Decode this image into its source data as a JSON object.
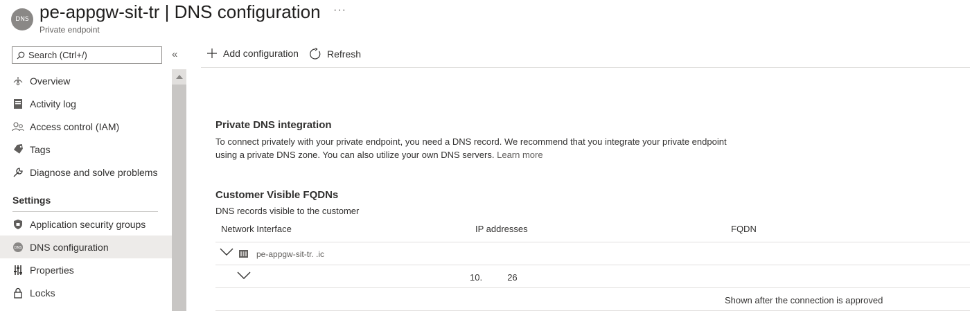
{
  "header": {
    "icon_text": "DNS",
    "resource_name": "pe-appgw-sit-tr",
    "separator": " | ",
    "page_name": "DNS configuration",
    "more": "···",
    "subtitle": "Private endpoint"
  },
  "sidebar": {
    "search_placeholder": "Search (Ctrl+/)",
    "collapse": "«",
    "items": [
      {
        "label": "Overview",
        "icon": "overview-icon"
      },
      {
        "label": "Activity log",
        "icon": "activity-log-icon"
      },
      {
        "label": "Access control (IAM)",
        "icon": "access-control-icon"
      },
      {
        "label": "Tags",
        "icon": "tag-icon"
      },
      {
        "label": "Diagnose and solve problems",
        "icon": "wrench-icon"
      }
    ],
    "settings_header": "Settings",
    "settings_items": [
      {
        "label": "Application security groups",
        "icon": "shield-icon"
      },
      {
        "label": "DNS configuration",
        "icon": "dns-icon",
        "selected": true
      },
      {
        "label": "Properties",
        "icon": "properties-icon"
      },
      {
        "label": "Locks",
        "icon": "lock-icon"
      }
    ]
  },
  "toolbar": {
    "add_label": "Add configuration",
    "refresh_label": "Refresh"
  },
  "main": {
    "integration_title": "Private DNS integration",
    "integration_text": "To connect privately with your private endpoint, you need a DNS record. We recommend that you integrate your private endpoint using a private DNS zone. You can also utilize your own DNS servers.",
    "learn_more": "Learn more",
    "fqdn_title": "Customer Visible FQDNs",
    "fqdn_subtitle": "DNS records visible to the customer",
    "columns": [
      "Network Interface",
      "IP addresses",
      "FQDN"
    ],
    "nic_name": "pe-appgw-sit-tr.  .ic",
    "ip_address": "10.          26",
    "fqdn_note": "Shown after the connection is approved"
  },
  "colors": {
    "selected_bg": "#edebe9",
    "scrollbar": "#c8c6c4",
    "text": "#323130",
    "muted": "#605e5c"
  }
}
